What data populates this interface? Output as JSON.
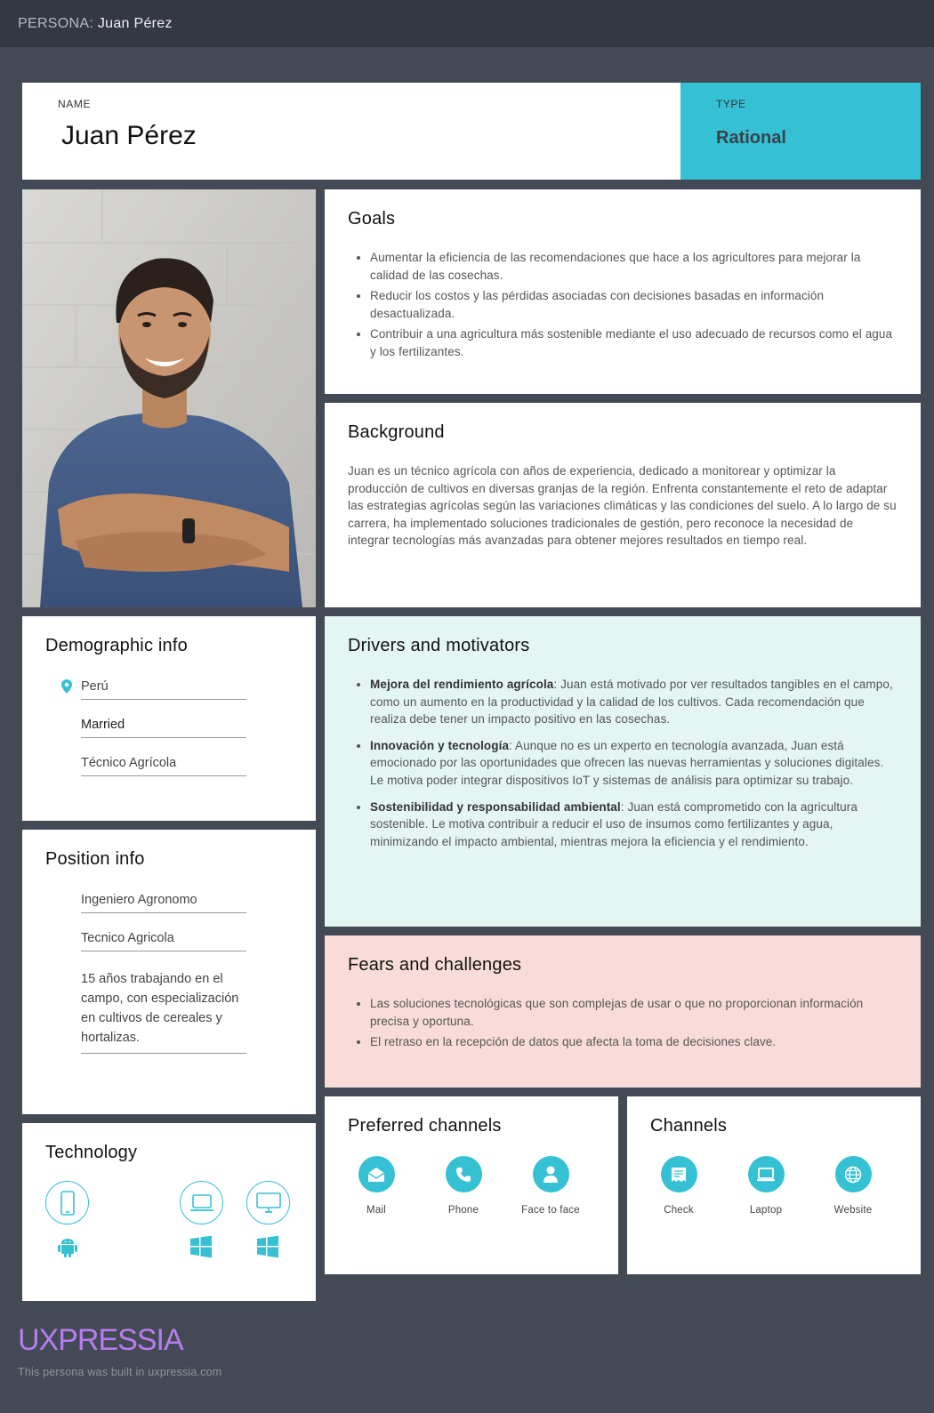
{
  "topbar": {
    "prefix": "PERSONA:",
    "name": "Juan Pérez"
  },
  "persona": {
    "name_label": "NAME",
    "name": "Juan Pérez",
    "type_label": "TYPE",
    "type": "Rational"
  },
  "goals": {
    "title": "Goals",
    "items": [
      "Aumentar la eficiencia de las recomendaciones que hace a los agricultores para mejorar la calidad de las cosechas.",
      "Reducir los costos y las pérdidas asociadas con decisiones basadas en información desactualizada.",
      "Contribuir a una agricultura más sostenible mediante el uso adecuado de recursos como el agua y los fertilizantes."
    ]
  },
  "background": {
    "title": "Background",
    "text": "Juan es un técnico agrícola con años de experiencia, dedicado a monitorear y optimizar la producción de cultivos en diversas granjas de la región. Enfrenta constantemente el reto de adaptar las estrategias agrícolas según las variaciones climáticas y las condiciones del suelo. A lo largo de su carrera, ha implementado soluciones tradicionales de gestión, pero reconoce la necesidad de integrar tecnologías más avanzadas para obtener mejores resultados en tiempo real."
  },
  "demographic": {
    "title": "Demographic info",
    "location": "Perú",
    "status": "Married",
    "occupation": "Técnico Agrícola"
  },
  "drivers": {
    "title": "Drivers and motivators",
    "items": [
      {
        "bold": "Mejora del rendimiento agrícola",
        "text": ": Juan está motivado por ver resultados tangibles en el campo, como un aumento en la productividad y la calidad de los cultivos. Cada recomendación que realiza debe tener un impacto positivo en las cosechas."
      },
      {
        "bold": "Innovación y tecnología",
        "text": ": Aunque no es un experto en tecnología avanzada, Juan está emocionado por las oportunidades que ofrecen las nuevas herramientas y soluciones digitales. Le motiva poder integrar dispositivos IoT y sistemas de análisis para optimizar su trabajo."
      },
      {
        "bold": "Sostenibilidad y responsabilidad ambiental",
        "text": ": Juan está comprometido con la agricultura sostenible. Le motiva contribuir a reducir el uso de insumos como fertilizantes y agua, minimizando el impacto ambiental, mientras mejora la eficiencia y el rendimiento."
      }
    ]
  },
  "position": {
    "title": "Position info",
    "role": "Ingeniero Agronomo",
    "title2": "Tecnico Agricola",
    "experience": "15 años trabajando en el campo, con especialización en cultivos de cereales y hortalizas."
  },
  "fears": {
    "title": "Fears and challenges",
    "items": [
      "Las soluciones tecnológicas que son complejas de usar o que no proporcionan información precisa y oportuna.",
      "El retraso en la recepción de datos que afecta la toma de decisiones clave."
    ]
  },
  "technology": {
    "title": "Technology",
    "devices": [
      {
        "device": "phone-icon",
        "os": "android-icon"
      },
      {
        "device": "laptop-icon",
        "os": "windows-icon"
      },
      {
        "device": "desktop-icon",
        "os": "windows-icon"
      }
    ]
  },
  "preferred_channels": {
    "title": "Preferred channels",
    "items": [
      {
        "label": "Mail",
        "icon": "mail-icon"
      },
      {
        "label": "Phone",
        "icon": "phone-icon"
      },
      {
        "label": "Face to face",
        "icon": "person-icon"
      }
    ]
  },
  "channels": {
    "title": "Channels",
    "items": [
      {
        "label": "Check",
        "icon": "check-icon"
      },
      {
        "label": "Laptop",
        "icon": "laptop-icon"
      },
      {
        "label": "Website",
        "icon": "globe-icon"
      }
    ]
  },
  "footer": {
    "logo": "UXPRESSIA",
    "note": "This persona was built in uxpressia.com"
  },
  "colors": {
    "accent": "#35c1d3",
    "drivers_bg": "#e3f6f3",
    "fears_bg": "#f9dcd9",
    "page_bg": "#444a55",
    "logo": "#b77cf0"
  }
}
